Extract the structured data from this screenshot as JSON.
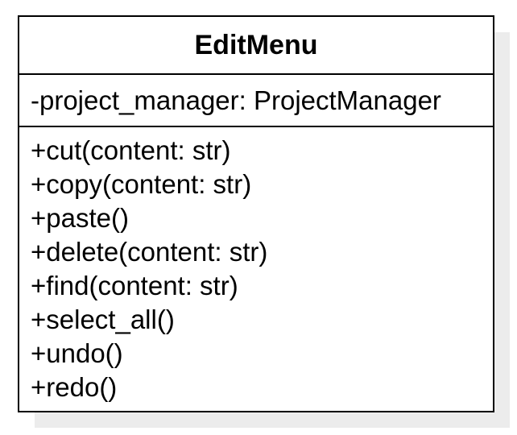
{
  "class": {
    "name": "EditMenu",
    "attributes": [
      "-project_manager: ProjectManager"
    ],
    "methods": [
      "+cut(content: str)",
      "+copy(content: str)",
      "+paste()",
      "+delete(content: str)",
      "+find(content: str)",
      "+select_all()",
      "+undo()",
      "+redo()"
    ]
  }
}
